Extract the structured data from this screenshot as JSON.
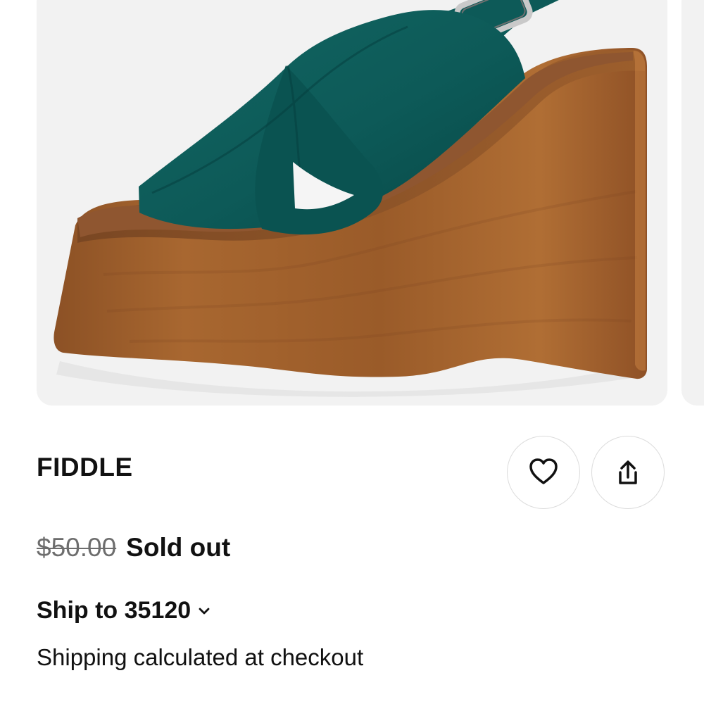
{
  "product": {
    "name": "FIDDLE",
    "original_price": "$50.00",
    "status": "Sold out",
    "image_alt": "Green suede crisscross wedge sandal"
  },
  "actions": {
    "favorite_icon": "heart-icon",
    "share_icon": "share-icon"
  },
  "shipping": {
    "ship_to_label": "Ship to 35120",
    "chevron_icon": "chevron-down-icon",
    "note": "Shipping calculated at checkout"
  },
  "colors": {
    "suede": "#0f5b58",
    "wood": "#9a5c2b",
    "text": "#111111",
    "muted": "#6d6d6d",
    "border": "#dcdcdc",
    "image_background": "#f2f2f2"
  }
}
